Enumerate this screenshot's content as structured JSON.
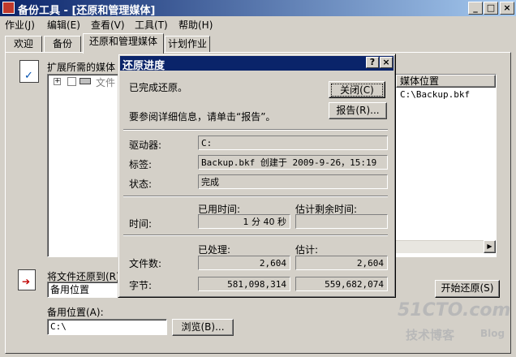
{
  "window": {
    "title": "备份工具 - [还原和管理媒体]"
  },
  "menu": [
    "作业(J)",
    "编辑(E)",
    "查看(V)",
    "工具(T)",
    "帮助(H)"
  ],
  "tabs": [
    "欢迎",
    "备份",
    "还原和管理媒体",
    "计划作业"
  ],
  "restore_panel": {
    "expand_label": "扩展所需的媒体",
    "tree_item": "文件",
    "column_header": "媒体位置",
    "column_value": "C:\\Backup.bkf",
    "restore_to_label": "将文件还原到(R)",
    "restore_to_value": "备用位置",
    "alt_location_label": "备用位置(A):",
    "alt_location_value": "C:\\",
    "browse_label": "浏览(B)...",
    "start_restore_label": "开始还原(S)"
  },
  "dialog": {
    "title": "还原进度",
    "help_glyph": "?",
    "close_glyph": "×",
    "status_text": "已完成还原。",
    "hint_text": "要参阅详细信息，请单击“报告”。",
    "close_label": "关闭(C)",
    "report_label": "报告(R)...",
    "drive_label": "驱动器:",
    "drive_value": "C:",
    "tag_label": "标签:",
    "tag_value": "Backup.bkf 创建于 2009-9-26，15:19",
    "state_label": "状态:",
    "state_value": "完成",
    "elapsed_header": "已用时间:",
    "remaining_header": "估计剩余时间:",
    "time_label": "时间:",
    "elapsed_value": "1 分 40 秒",
    "remaining_value": "",
    "processed_header": "已处理:",
    "estimated_header": "估计:",
    "files_label": "文件数:",
    "files_processed": "2,604",
    "files_estimated": "2,604",
    "bytes_label": "字节:",
    "bytes_processed": "581,098,314",
    "bytes_estimated": "559,682,074"
  },
  "watermark": {
    "brand": "51CTO.com",
    "sub": "技术博客",
    "blog": "Blog"
  }
}
